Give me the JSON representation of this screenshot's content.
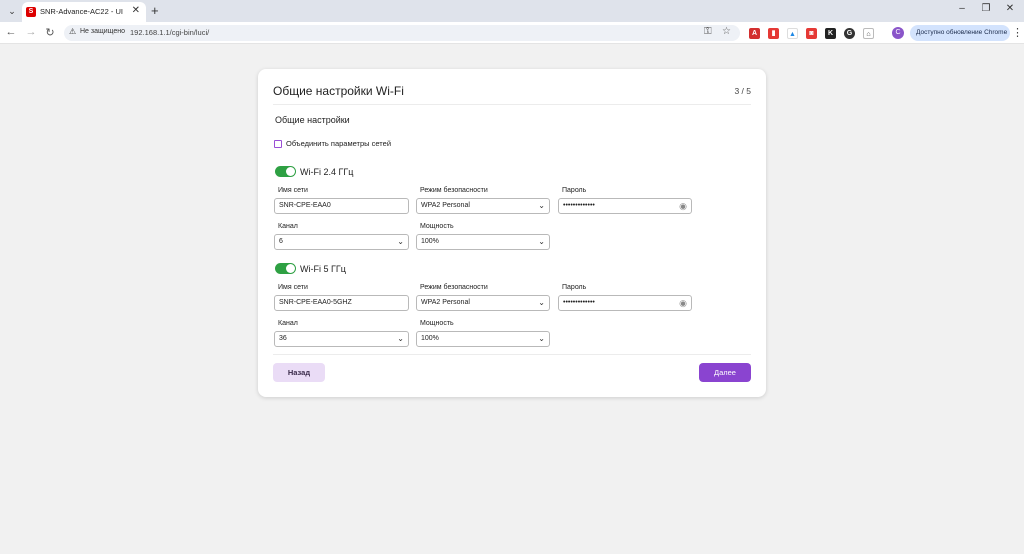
{
  "browser": {
    "tab_title": "SNR-Advance-AC22 - UI",
    "tab_favicon_letter": "S",
    "security_label": "Не защищено",
    "url": "192.168.1.1/cgi-bin/luci/",
    "profile_letter": "C",
    "update_label": "Доступно обновление Chrome",
    "icons": [
      "tab-dropdown-icon",
      "close-icon",
      "plus-icon",
      "minimize-icon",
      "restore-icon",
      "back-icon",
      "forward-icon",
      "reload-icon",
      "warning-icon",
      "key-icon",
      "star-icon",
      "kebab-menu-icon"
    ]
  },
  "card": {
    "title": "Общие настройки Wi-Fi",
    "step": "3 / 5",
    "section_title": "Общие настройки",
    "merge_label": "Объединить параметры сетей",
    "merge_checked": false
  },
  "bands": [
    {
      "label": "Wi-Fi 2.4 ГГц",
      "enabled": true,
      "ssid_label": "Имя сети",
      "ssid": "SNR-CPE-EAA0",
      "security_label": "Режим безопасности",
      "security": "WPA2 Personal",
      "password_label": "Пароль",
      "password": "•••••••••••••",
      "channel_label": "Канал",
      "channel": "6",
      "power_label": "Мощность",
      "power": "100%"
    },
    {
      "label": "Wi-Fi 5 ГГц",
      "enabled": true,
      "ssid_label": "Имя сети",
      "ssid": "SNR-CPE-EAA0-5GHZ",
      "security_label": "Режим безопасности",
      "security": "WPA2 Personal",
      "password_label": "Пароль",
      "password": "•••••••••••••",
      "channel_label": "Канал",
      "channel": "36",
      "power_label": "Мощность",
      "power": "100%"
    }
  ],
  "actions": {
    "back_label": "Назад",
    "next_label": "Далее"
  },
  "colors": {
    "accent": "#8a44d0",
    "toggle_on": "#2ea043",
    "back_bg": "#eadcf6"
  }
}
